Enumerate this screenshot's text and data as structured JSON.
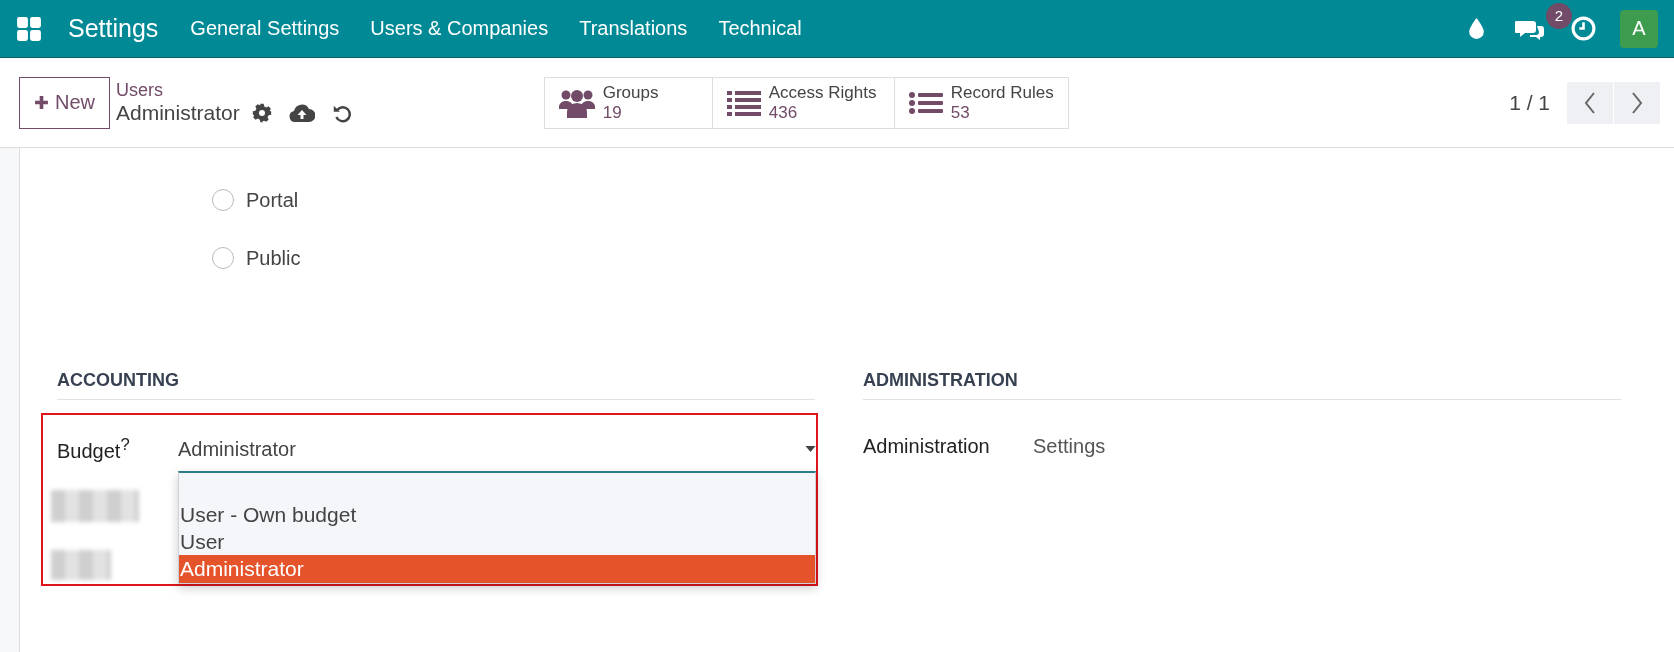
{
  "navbar": {
    "app_name": "Settings",
    "menu": [
      "General Settings",
      "Users & Companies",
      "Translations",
      "Technical"
    ],
    "messages_badge": "2",
    "avatar": "A"
  },
  "control_panel": {
    "new_button": "New",
    "breadcrumb": "Users",
    "record_title": "Administrator",
    "stat_buttons": [
      {
        "label": "Groups",
        "value": "19",
        "kind": "groups"
      },
      {
        "label": "Access Rights",
        "value": "436",
        "kind": "list"
      },
      {
        "label": "Record Rules",
        "value": "53",
        "kind": "rules"
      }
    ],
    "pager": "1 / 1"
  },
  "user_type_options": [
    {
      "label": "Portal",
      "selected": false
    },
    {
      "label": "Public",
      "selected": false
    }
  ],
  "sections": [
    {
      "title": "ACCOUNTING",
      "field": {
        "label": "Budget",
        "help_mark": "?",
        "value": "Administrator",
        "dropdown_open": true,
        "options": [
          {
            "label": "User - Own budget",
            "selected": false
          },
          {
            "label": "User",
            "selected": false
          },
          {
            "label": "Administrator",
            "selected": true
          }
        ]
      }
    },
    {
      "title": "ADMINISTRATION",
      "field": {
        "label": "Administration",
        "value": "Settings"
      }
    }
  ]
}
